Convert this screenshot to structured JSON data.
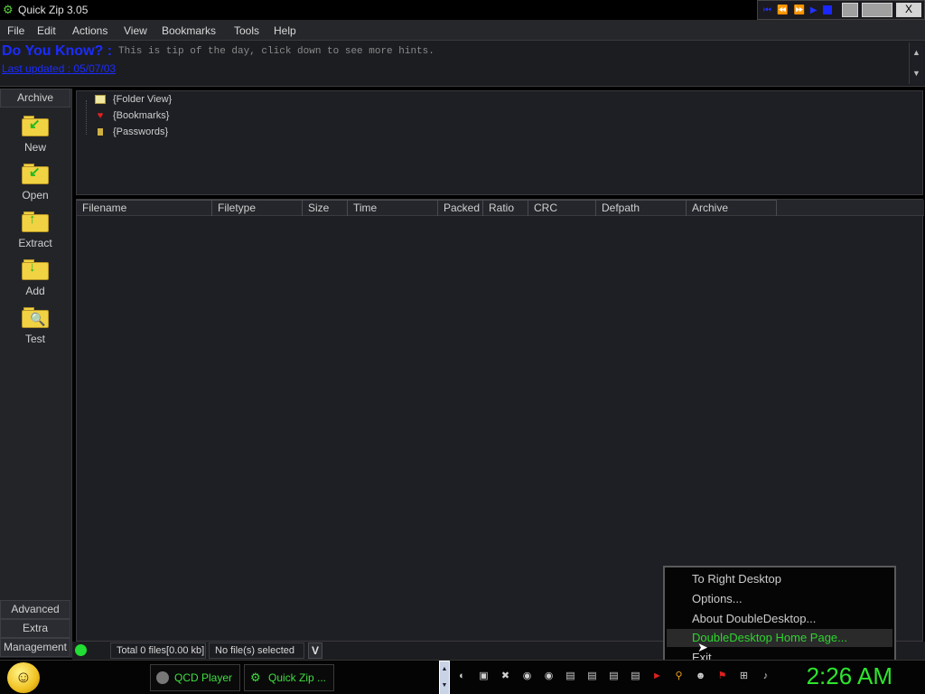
{
  "window": {
    "title": "Quick Zip 3.05",
    "close_glyph": "X"
  },
  "menu": [
    "File",
    "Edit",
    "Actions",
    "View",
    "Bookmarks",
    "Tools",
    "Help"
  ],
  "tip": {
    "heading": "Do You Know? :",
    "text": "This is tip of the day, click down to see more hints.",
    "updated": "Last updated : 05/07/03"
  },
  "sidebar": {
    "top_tab": "Archive",
    "tools": [
      {
        "label": "New",
        "icon": "new-archive-icon"
      },
      {
        "label": "Open",
        "icon": "open-archive-icon"
      },
      {
        "label": "Extract",
        "icon": "extract-icon"
      },
      {
        "label": "Add",
        "icon": "add-files-icon"
      },
      {
        "label": "Test",
        "icon": "test-archive-icon"
      }
    ],
    "bottom_tabs": [
      "Advanced",
      "Extra",
      "Management"
    ]
  },
  "tree": {
    "items": [
      "{Folder View}",
      "{Bookmarks}",
      "{Passwords}"
    ]
  },
  "filelist": {
    "columns": [
      "Filename",
      "Filetype",
      "Size",
      "Time",
      "Packed",
      "Ratio",
      "CRC",
      "Defpath",
      "Archive"
    ]
  },
  "status": {
    "total": "Total 0 files[0.00 kb]",
    "selected": "No file(s) selected",
    "v_button": "V"
  },
  "context_menu": {
    "items": [
      "To Right Desktop",
      "Options...",
      "About DoubleDesktop...",
      "DoubleDesktop Home Page...",
      "Exit"
    ],
    "highlighted_index": 3
  },
  "taskbar": {
    "buttons": [
      {
        "label": "QCD Player",
        "icon": "qcd-player-icon"
      },
      {
        "label": "Quick Zip ...",
        "icon": "quick-zip-icon"
      }
    ],
    "clock": "2:26 AM",
    "tray_icons": [
      "network-icon",
      "window-icon",
      "remove-icon",
      "ac-icon",
      "ac2-icon",
      "monitor-icon",
      "monitor2-icon",
      "monitor3-icon",
      "monitor4-icon",
      "arrow-icon",
      "search-icon",
      "messenger-icon",
      "flag-icon",
      "network-status-icon",
      "volume-icon"
    ]
  },
  "colors": {
    "accent_green": "#2ee52e",
    "link_blue": "#1b2cff",
    "background": "#1e1f24"
  }
}
